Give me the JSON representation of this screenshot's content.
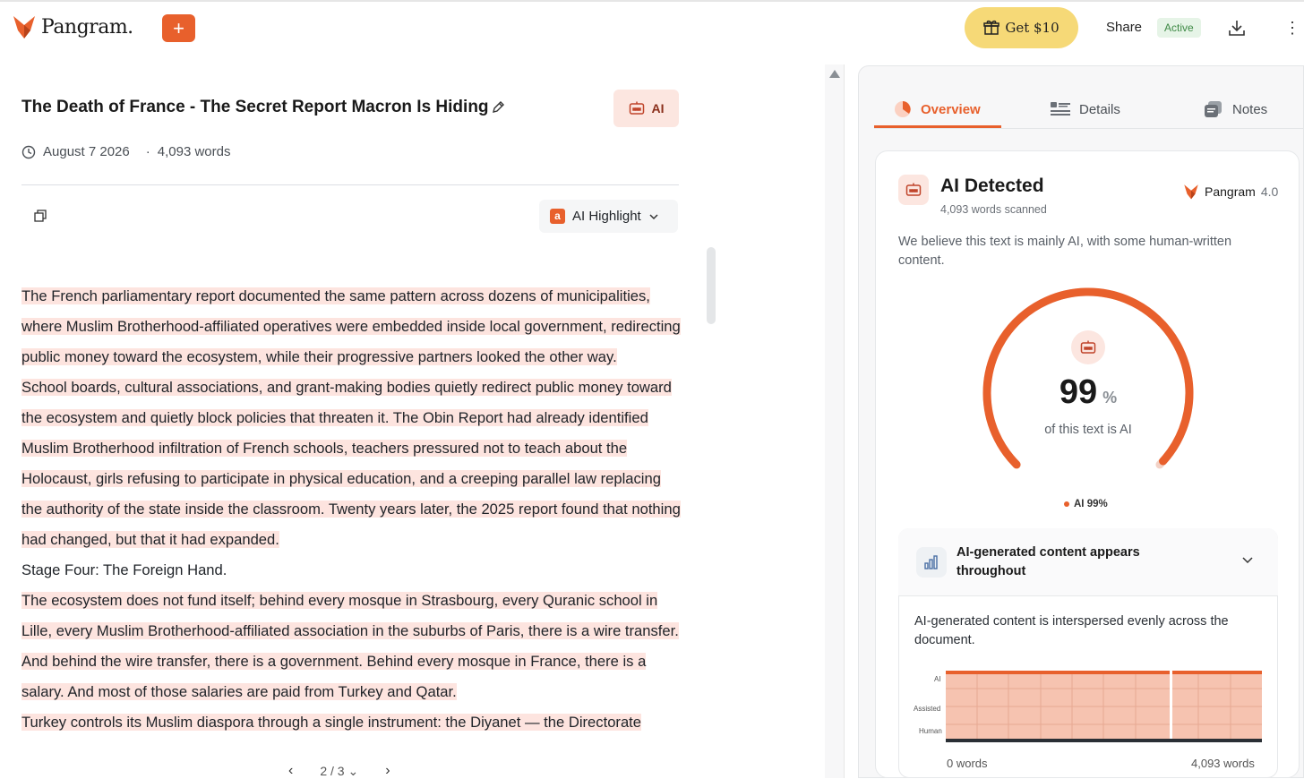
{
  "header": {
    "brand": "Pangram.",
    "promo_label": "Get $10",
    "share_label": "Share",
    "status_badge": "Active"
  },
  "document": {
    "title": "The Death of France - The Secret Report Macron Is Hiding",
    "ai_chip_label": "AI",
    "date": "August 7 2026",
    "separator": "·",
    "word_count": "4,093 words",
    "highlight_mode": "AI Highlight",
    "highlight_badge": "a",
    "paragraphs": [
      "The French parliamentary report documented the same pattern across dozens of municipalities, where Muslim Brotherhood-affiliated operatives were embedded inside local government, redirecting public money toward the ecosystem, while their progressive partners looked the other way.",
      "School boards, cultural associations, and grant-making bodies quietly redirect public money toward the ecosystem and quietly block policies that threaten it. The Obin Report had already identified Muslim Brotherhood infiltration of French schools, teachers pressured not to teach about the Holocaust, girls refusing to participate in physical education, and a creeping parallel law replacing the authority of the state inside the classroom. Twenty years later, the 2025 report found that nothing had changed, but that it had expanded.",
      "Stage Four: The Foreign Hand.",
      "The ecosystem does not fund itself; behind every mosque in Strasbourg, every Quranic school in Lille, every Muslim Brotherhood-affiliated association in the suburbs of Paris, there is a wire transfer. And behind the wire transfer, there is a government. Behind every mosque in France, there is a salary. And most of those salaries are paid from Turkey and Qatar.",
      "Turkey controls its Muslim diaspora through a single instrument: the Diyanet — the Directorate"
    ],
    "paragraph_highlighted": [
      true,
      true,
      false,
      true,
      true
    ],
    "pager": {
      "current": "2 / 3"
    }
  },
  "sidebar": {
    "tabs": [
      {
        "label": "Overview",
        "active": true
      },
      {
        "label": "Details",
        "active": false
      },
      {
        "label": "Notes",
        "active": false
      }
    ],
    "result": {
      "title": "AI Detected",
      "subtitle": "4,093 words scanned",
      "model_name": "Pangram",
      "model_version": "4.0",
      "summary": "We believe this text is mainly AI, with some human-written content.",
      "ai_percent": 99,
      "percent_sign": "%",
      "percent_label": "of this text is AI",
      "legend": "AI 99%"
    },
    "accordion": {
      "title": "AI-generated content appears throughout",
      "description": "AI-generated content is interspersed evenly across the document.",
      "levels": [
        "AI",
        "Assisted",
        "Human"
      ],
      "axis_start": "0 words",
      "axis_end": "4,093 words"
    }
  },
  "colors": {
    "accent": "#e8602c",
    "highlight": "#fde4df",
    "promo": "#f6d977",
    "active_badge_bg": "#e6f4e7",
    "active_badge_text": "#3f8a46"
  },
  "icons": {
    "logo": "fox-logo-icon",
    "add": "plus-icon",
    "promo": "gift-icon",
    "download": "download-icon",
    "menu": "kebab-menu-icon",
    "edit": "pencil-icon",
    "ai": "robot-icon",
    "date": "clock-icon",
    "copy": "copy-icon",
    "chevron": "chevron-down-icon",
    "chart": "bar-chart-icon"
  }
}
